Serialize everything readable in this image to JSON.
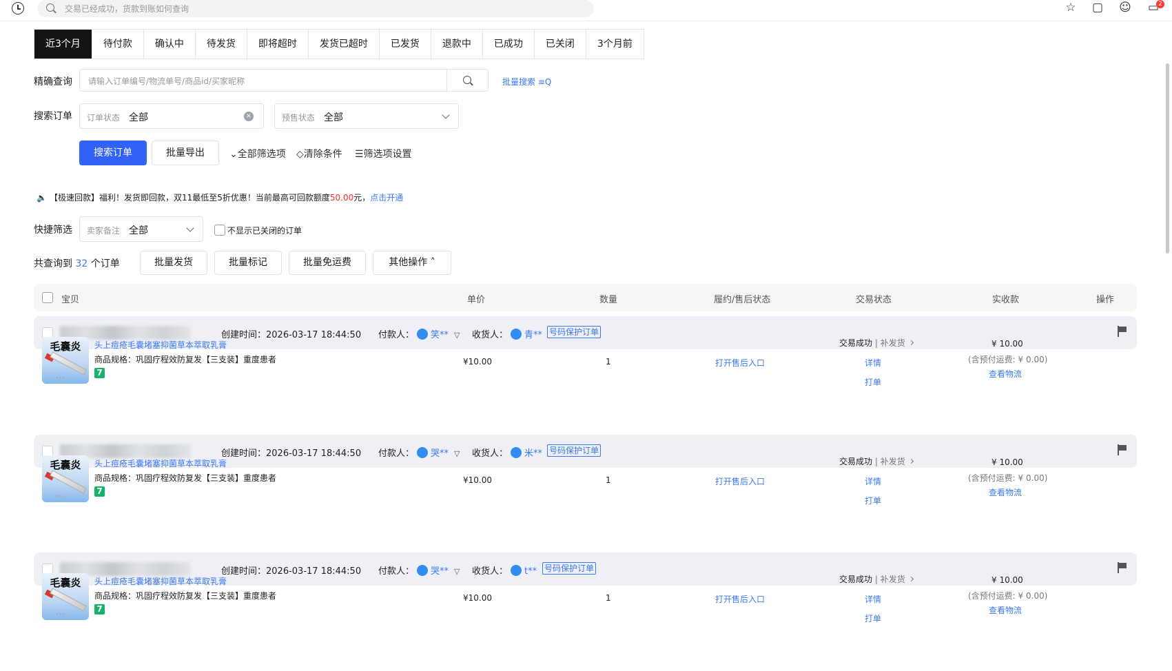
{
  "topbar": {
    "search_placeholder": "交易已经成功，货款到账如何查询",
    "icons": [
      "history-icon",
      "search-icon",
      "star-icon",
      "bookmark-icon",
      "emoji-icon",
      "message-icon"
    ],
    "message_badge": "2"
  },
  "tabs": [
    {
      "label": "近3个月",
      "active": true
    },
    {
      "label": "待付款"
    },
    {
      "label": "确认中"
    },
    {
      "label": "待发货"
    },
    {
      "label": "即将超时"
    },
    {
      "label": "发货已超时"
    },
    {
      "label": "已发货"
    },
    {
      "label": "退款中"
    },
    {
      "label": "已成功"
    },
    {
      "label": "已关闭"
    },
    {
      "label": "3个月前"
    }
  ],
  "precise": {
    "label": "精确查询",
    "placeholder": "请输入订单编号/物流单号/商品id/买家昵称",
    "batch_link": "批量搜索"
  },
  "search_orders": {
    "label": "搜索订单",
    "order_status_key": "订单状态",
    "order_status_value": "全部",
    "presale_key": "预售状态",
    "presale_value": "全部"
  },
  "actions": {
    "search_button": "搜索订单",
    "export_button": "批量导出",
    "all_filters": "全部筛选项",
    "clear_filters": "清除条件",
    "filter_settings": "筛选项设置"
  },
  "notice": {
    "prefix": "【极速回款】福利！发货即回款，双11最低至5折优惠！当前最高可回款额度",
    "amount": "50.00",
    "unit": "元，",
    "link": "点击开通"
  },
  "quick": {
    "label": "快捷筛选",
    "remark_key": "卖家备注",
    "remark_value": "全部",
    "hide_closed": "不显示已关闭的订单"
  },
  "summary": {
    "prefix": "共查询到",
    "count": "32",
    "suffix": "个订单",
    "batch_ship": "批量发货",
    "batch_mark": "批量标记",
    "batch_free": "批量免运费",
    "other_ops": "其他操作"
  },
  "table_headers": {
    "item": "宝贝",
    "price": "单价",
    "qty": "数量",
    "fulfil": "履约/售后状态",
    "trade": "交易状态",
    "received": "实收款",
    "ops": "操作"
  },
  "orders": [
    {
      "created_label": "创建时间：",
      "created_time": "2026-03-17 18:44:50",
      "payer_label": "付款人：",
      "payer": "笑**",
      "receiver_label": "收货人：",
      "receiver": "青**",
      "tag": "号码保护订单",
      "image_title": "毛囊炎",
      "product_name": "头上痘疮毛囊堵塞抑菌草本萃取乳膏",
      "product_spec": "商品规格：巩固疗程效防复发【三支装】重度患者",
      "badge": "7",
      "price": "¥10.00",
      "qty": "1",
      "after_sale": "打开售后入口",
      "trade_status": "交易成功",
      "reship": "补发货",
      "detail": "详情",
      "print": "打单",
      "received": "¥ 10.00",
      "shipping": "(含预付运费: ¥ 0.00)",
      "logistics": "查看物流"
    },
    {
      "created_label": "创建时间：",
      "created_time": "2026-03-17 18:44:50",
      "payer_label": "付款人：",
      "payer": "哭**",
      "receiver_label": "收货人：",
      "receiver": "米**",
      "tag": "号码保护订单",
      "image_title": "毛囊炎",
      "product_name": "头上痘疮毛囊堵塞抑菌草本萃取乳膏",
      "product_spec": "商品规格：巩固疗程效防复发【三支装】重度患者",
      "badge": "7",
      "price": "¥10.00",
      "qty": "1",
      "after_sale": "打开售后入口",
      "trade_status": "交易成功",
      "reship": "补发货",
      "detail": "详情",
      "print": "打单",
      "received": "¥ 10.00",
      "shipping": "(含预付运费: ¥ 0.00)",
      "logistics": "查看物流"
    },
    {
      "created_label": "创建时间：",
      "created_time": "2026-03-17 18:44:50",
      "payer_label": "付款人：",
      "payer": "哭**",
      "receiver_label": "收货人：",
      "receiver": "t**",
      "tag": "号码保护订单",
      "image_title": "毛囊炎",
      "product_name": "头上痘疮毛囊堵塞抑菌草本萃取乳膏",
      "product_spec": "商品规格：巩固疗程效防复发【三支装】重度患者",
      "badge": "7",
      "price": "¥10.00",
      "qty": "1",
      "after_sale": "打开售后入口",
      "trade_status": "交易成功",
      "reship": "补发货",
      "detail": "详情",
      "print": "打单",
      "received": "¥ 10.00",
      "shipping": "(含预付运费: ¥ 0.00)",
      "logistics": "查看物流"
    }
  ]
}
